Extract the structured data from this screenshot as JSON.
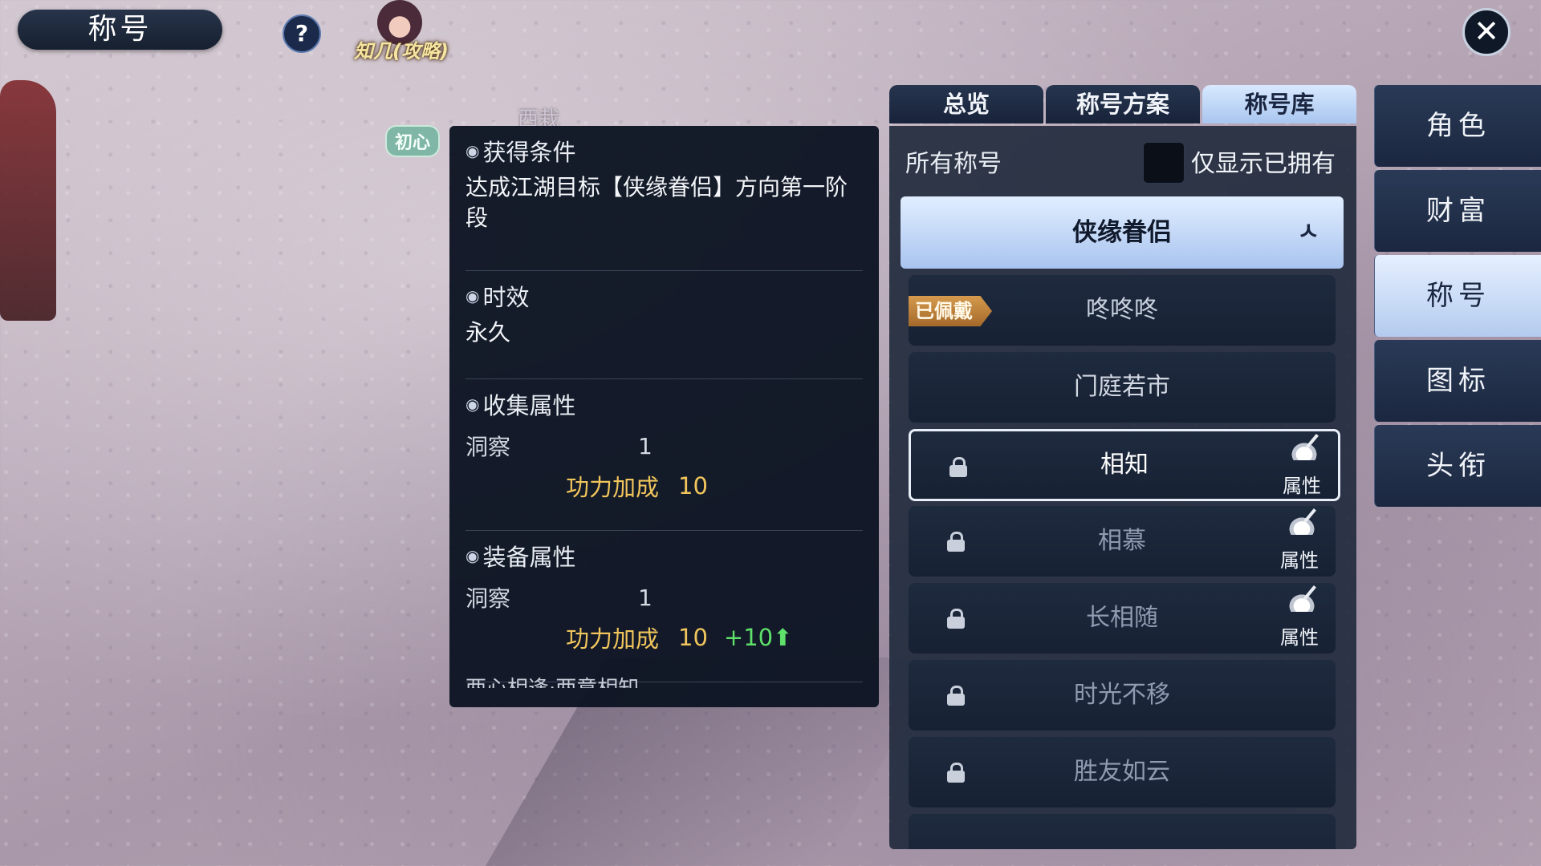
{
  "header": {
    "title": "称号",
    "help_label": "?",
    "guide_label": "知几(攻略)"
  },
  "scene": {
    "npc_name": "西栽",
    "npc_badge": "初心"
  },
  "close_label": "✕",
  "tooltip": {
    "conditions_heading": "获得条件",
    "conditions_text": "达成江湖目标【侠缘眷侣】方向第一阶段",
    "duration_heading": "时效",
    "duration_text": "永久",
    "collect_heading": "收集属性",
    "collect_stat_name": "洞察",
    "collect_stat_value": "1",
    "collect_power_label": "功力加成",
    "collect_power_value": "10",
    "equip_heading": "装备属性",
    "equip_stat_name": "洞察",
    "equip_stat_value": "1",
    "equip_power_label": "功力加成",
    "equip_power_value": "10",
    "equip_power_bonus": "+10⬆",
    "cut_text": "两心相逢·两意相知"
  },
  "tabs": [
    "总览",
    "称号方案",
    "称号库"
  ],
  "active_tab": "称号库",
  "filter": {
    "label": "所有称号",
    "owned_only_label": "仅显示已拥有",
    "owned_only_checked": false
  },
  "group": {
    "name": "侠缘眷侣",
    "collapse_icon": "ㅅ"
  },
  "equipped_badge": "已佩戴",
  "attr_label": "属性",
  "titles": [
    {
      "name": "咚咚咚",
      "equipped": true,
      "locked": false
    },
    {
      "name": "门庭若市",
      "equipped": false,
      "locked": false
    },
    {
      "name": "相知",
      "locked": true,
      "selected": true,
      "has_attr": true
    },
    {
      "name": "相慕",
      "locked": true,
      "has_attr": true
    },
    {
      "name": "长相随",
      "locked": true,
      "has_attr": true
    },
    {
      "name": "时光不移",
      "locked": true
    },
    {
      "name": "胜友如云",
      "locked": true
    }
  ],
  "side_tabs": [
    "角色",
    "财富",
    "称号",
    "图标",
    "头衔"
  ],
  "active_side_tab": "称号",
  "colors": {
    "accent": "#b3cbef",
    "gold": "#f0c55c",
    "green": "#5ee06a",
    "panel": "#222c3e"
  }
}
